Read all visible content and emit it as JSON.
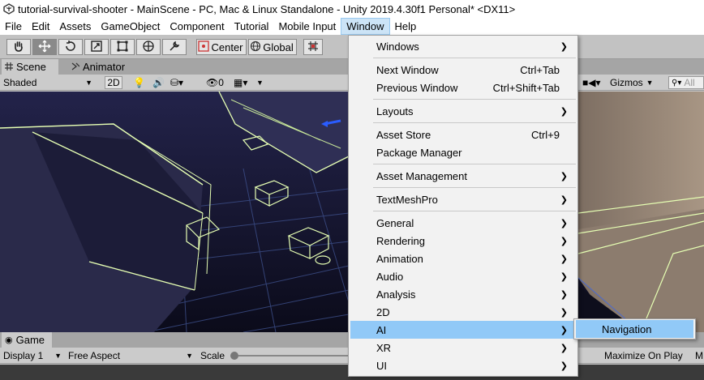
{
  "window": {
    "title": "tutorial-survival-shooter - MainScene - PC, Mac & Linux Standalone - Unity 2019.4.30f1 Personal* <DX11>",
    "logo_icon": "unity-logo-icon"
  },
  "menubar": {
    "items": [
      "File",
      "Edit",
      "Assets",
      "GameObject",
      "Component",
      "Tutorial",
      "Mobile Input",
      "Window",
      "Help"
    ],
    "active": "Window"
  },
  "toolbar": {
    "pivot_label": "Center",
    "space_label": "Global",
    "tools": [
      "hand-tool-icon",
      "move-tool-icon",
      "rotate-tool-icon",
      "scale-tool-icon",
      "rect-tool-icon",
      "transform-tool-icon",
      "custom-tool-icon"
    ]
  },
  "tabs": {
    "scene": "Scene",
    "animator": "Animator"
  },
  "scene_toolbar": {
    "draw_mode": "Shaded",
    "mode_2d": "2D",
    "hidden_count": "0",
    "gizmos": "Gizmos",
    "search_placeholder": "All"
  },
  "game": {
    "tab": "Game",
    "display": "Display 1",
    "aspect": "Free Aspect",
    "scale": "Scale",
    "maximize": "Maximize On Play",
    "truncated_next": "M"
  },
  "window_menu": {
    "items": [
      {
        "label": "Windows",
        "submenu": true
      },
      {
        "label": "Next Window",
        "shortcut": "Ctrl+Tab"
      },
      {
        "label": "Previous Window",
        "shortcut": "Ctrl+Shift+Tab"
      },
      {
        "label": "Layouts",
        "submenu": true
      },
      {
        "label": "Asset Store",
        "shortcut": "Ctrl+9"
      },
      {
        "label": "Package Manager"
      },
      {
        "label": "Asset Management",
        "submenu": true
      },
      {
        "label": "TextMeshPro",
        "submenu": true
      },
      {
        "label": "General",
        "submenu": true
      },
      {
        "label": "Rendering",
        "submenu": true
      },
      {
        "label": "Animation",
        "submenu": true
      },
      {
        "label": "Audio",
        "submenu": true
      },
      {
        "label": "Analysis",
        "submenu": true
      },
      {
        "label": "2D",
        "submenu": true
      },
      {
        "label": "AI",
        "submenu": true,
        "highlighted": true
      },
      {
        "label": "XR",
        "submenu": true
      },
      {
        "label": "UI",
        "submenu": true
      }
    ]
  },
  "ai_submenu": {
    "items": [
      {
        "label": "Navigation",
        "highlighted": true
      }
    ]
  },
  "colors": {
    "menu_highlight": "#91c9f7",
    "menubar_active": "#cce4f7",
    "scene_wire": "#e6ffb3",
    "grid_blue": "#3d4f8a"
  }
}
